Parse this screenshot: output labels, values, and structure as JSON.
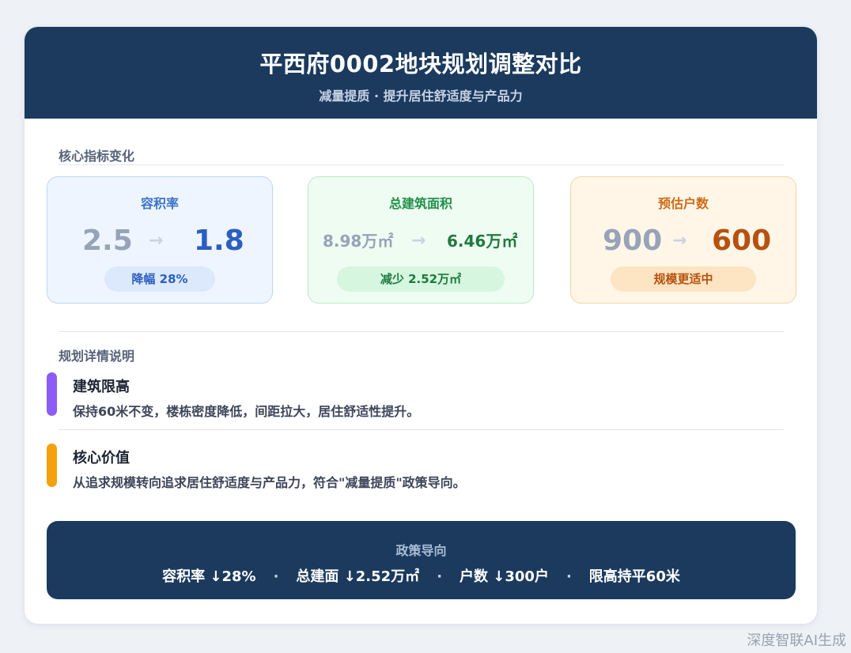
{
  "header": {
    "title": "平西府0002地块规划调整对比",
    "subtitle": "减量提质 · 提升居住舒适度与产品力"
  },
  "metrics_section": {
    "label": "核心指标变化",
    "cards": [
      {
        "title": "容积率",
        "before": "2.5",
        "after": "1.8",
        "badge": "降幅 28%",
        "accent": "#2a5fc0"
      },
      {
        "title": "总建筑面积",
        "before": "8.98万㎡",
        "after": "6.46万㎡",
        "badge": "减少 2.52万㎡",
        "accent": "#1e7a3d"
      },
      {
        "title": "预估户数",
        "before": "900",
        "after": "600",
        "badge": "规模更适中",
        "accent": "#b6520f"
      }
    ],
    "arrow": "→"
  },
  "details_section": {
    "label": "规划详情说明",
    "items": [
      {
        "title": "建筑限高",
        "text": "保持60米不变，楼栋密度降低，间距拉大，居住舒适性提升。",
        "bar_color": "#8b5cf6"
      },
      {
        "title": "核心价值",
        "text": "从追求规模转向追求居住舒适度与产品力，符合\"减量提质\"政策导向。",
        "bar_color": "#f5a00f"
      }
    ]
  },
  "footer": {
    "title": "政策导向",
    "items": [
      "容积率 ↓28%",
      "总建面 ↓2.52万㎡",
      "户数 ↓300户",
      "限高持平60米"
    ],
    "separator": "·"
  },
  "watermark": "深度智联AI生成",
  "colors": {
    "header_bg": "#1b3a5e",
    "page_bg": "#eef1f6"
  }
}
